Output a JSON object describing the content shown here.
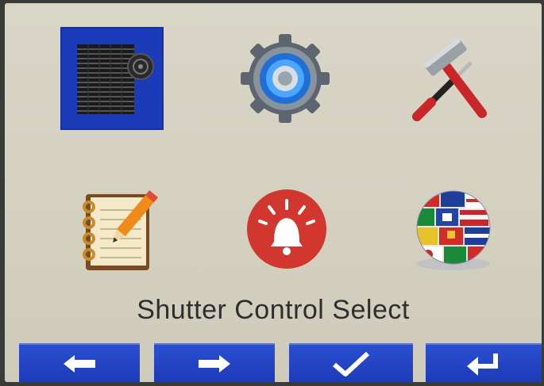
{
  "screen": {
    "title": "Shutter Control Select"
  },
  "menu": {
    "items": [
      {
        "name": "shutter-control",
        "icon": "shutter-icon",
        "selected": true
      },
      {
        "name": "settings",
        "icon": "gear-icon",
        "selected": false
      },
      {
        "name": "tools",
        "icon": "tools-icon",
        "selected": false
      },
      {
        "name": "log",
        "icon": "notepad-icon",
        "selected": false
      },
      {
        "name": "alarm",
        "icon": "alarm-bell-icon",
        "selected": false
      },
      {
        "name": "language",
        "icon": "globe-flags-icon",
        "selected": false
      }
    ]
  },
  "nav": {
    "buttons": [
      {
        "name": "previous",
        "icon": "arrow-left-icon"
      },
      {
        "name": "next",
        "icon": "arrow-right-icon"
      },
      {
        "name": "confirm",
        "icon": "checkmark-icon"
      },
      {
        "name": "back",
        "icon": "return-icon"
      }
    ]
  },
  "colors": {
    "selection": "#1c3bb8",
    "button": "#1f3fc0",
    "background": "#d6d2c3"
  }
}
